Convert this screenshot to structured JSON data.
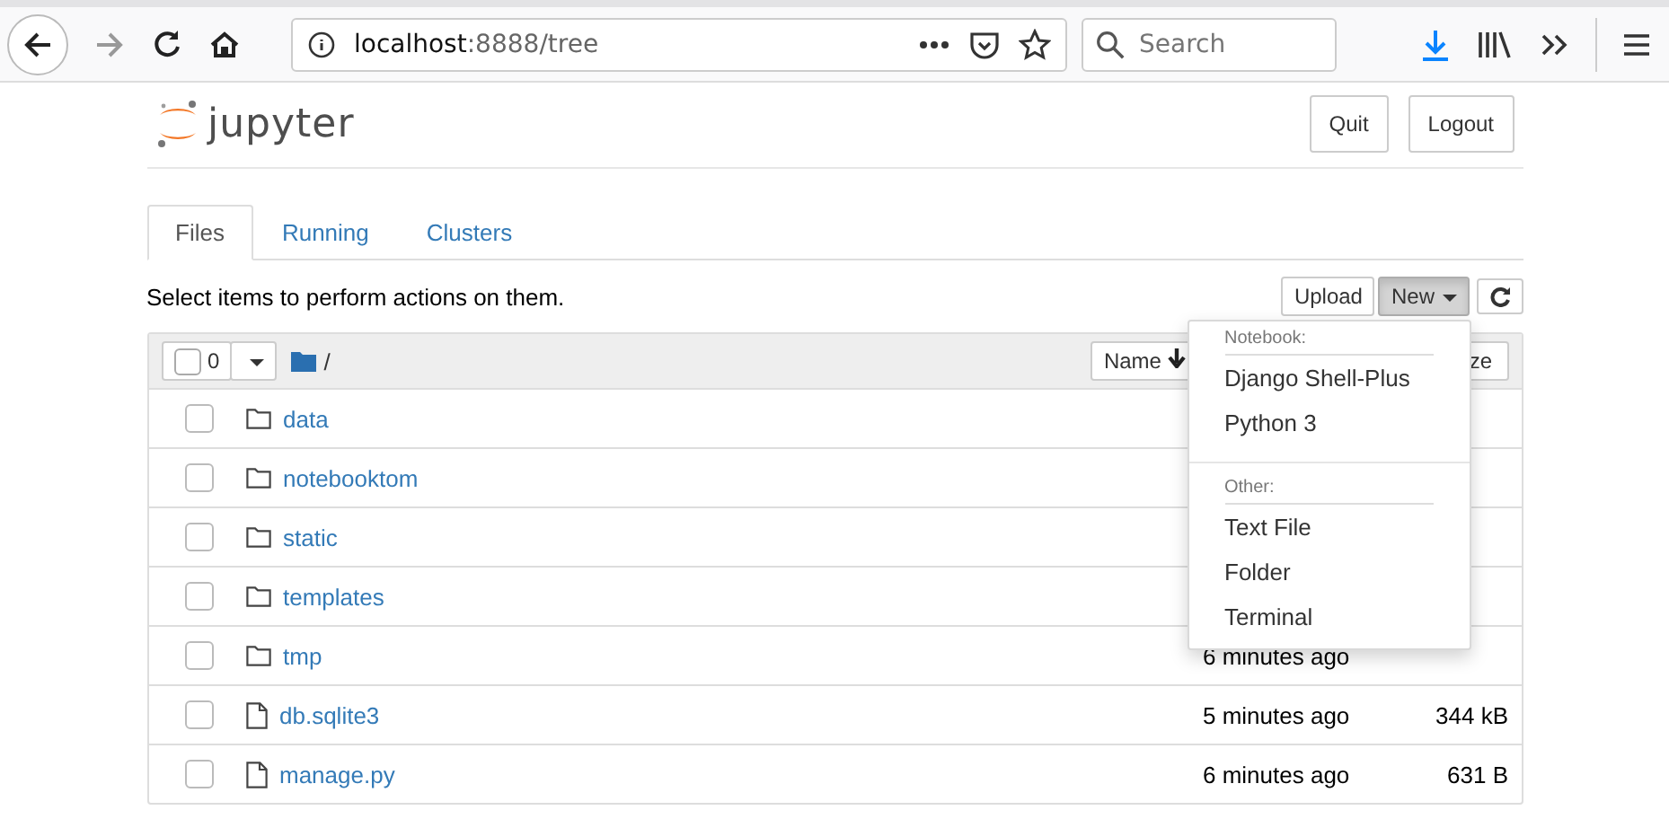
{
  "browser": {
    "url_host": "localhost",
    "url_rest": ":8888/tree",
    "search_placeholder": "Search"
  },
  "header": {
    "logo_text": "jupyter",
    "buttons": [
      "Quit",
      "Logout"
    ]
  },
  "tabs": [
    {
      "label": "Files",
      "selected": true
    },
    {
      "label": "Running",
      "selected": false
    },
    {
      "label": "Clusters",
      "selected": false
    }
  ],
  "toolbar": {
    "hint": "Select items to perform actions on them.",
    "upload": "Upload",
    "new": "New"
  },
  "list_header": {
    "selected_count": "0",
    "checked": false,
    "path": "/",
    "name_sort": "Name",
    "size_sort": "ze"
  },
  "files": [
    {
      "kind": "folder",
      "name": "data",
      "checked": false
    },
    {
      "kind": "folder",
      "name": "notebooktom",
      "checked": false
    },
    {
      "kind": "folder",
      "name": "static",
      "checked": false
    },
    {
      "kind": "folder",
      "name": "templates",
      "checked": false
    },
    {
      "kind": "folder",
      "name": "tmp",
      "checked": false,
      "modified": "6 minutes ago"
    },
    {
      "kind": "file",
      "name": "db.sqlite3",
      "checked": false,
      "modified": "5 minutes ago",
      "size": "344 kB"
    },
    {
      "kind": "file",
      "name": "manage.py",
      "checked": false,
      "modified": "6 minutes ago",
      "size": "631 B"
    }
  ],
  "new_menu": {
    "sections": [
      {
        "heading": "Notebook:",
        "items": [
          "Django Shell-Plus",
          "Python 3"
        ]
      },
      {
        "heading": "Other:",
        "items": [
          "Text File",
          "Folder",
          "Terminal"
        ]
      }
    ]
  }
}
